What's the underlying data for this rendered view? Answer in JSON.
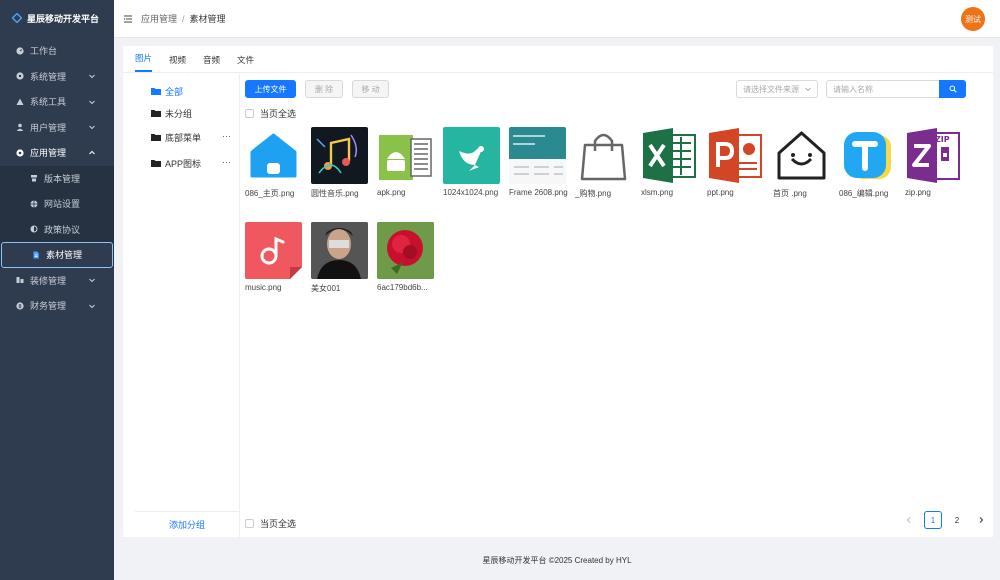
{
  "app": {
    "title": "星辰移动开发平台"
  },
  "sidebar": {
    "items": [
      {
        "label": "工作台",
        "icon": "dashboard-icon"
      },
      {
        "label": "系统管理",
        "icon": "settings-icon"
      },
      {
        "label": "系统工具",
        "icon": "tool-icon"
      },
      {
        "label": "用户管理",
        "icon": "user-icon"
      },
      {
        "label": "应用管理",
        "icon": "app-icon"
      },
      {
        "label": "版本管理",
        "icon": "version-icon"
      },
      {
        "label": "网站设置",
        "icon": "globe-icon"
      },
      {
        "label": "政策协议",
        "icon": "policy-icon"
      },
      {
        "label": "素材管理",
        "icon": "file-icon"
      },
      {
        "label": "装修管理",
        "icon": "decor-icon"
      },
      {
        "label": "财务管理",
        "icon": "finance-icon"
      }
    ]
  },
  "header": {
    "breadcrumb": [
      "应用管理",
      "/",
      "素材管理"
    ],
    "avatar_text": "测试"
  },
  "tabs": [
    "图片",
    "视频",
    "音频",
    "文件"
  ],
  "groups": [
    {
      "label": "全部"
    },
    {
      "label": "未分组"
    },
    {
      "label": "底部菜单",
      "more": "···"
    },
    {
      "label": "APP图标",
      "more": "···"
    }
  ],
  "add_group": "添加分组",
  "toolbar": {
    "upload": "上传文件",
    "delete": "删 除",
    "move": "移 动",
    "source_placeholder": "请选择文件来源",
    "search_placeholder": "请输入名称"
  },
  "select_all": "当页全选",
  "files": [
    {
      "name": "086_主页.png"
    },
    {
      "name": "圆性音乐.png"
    },
    {
      "name": "apk.png"
    },
    {
      "name": "1024x1024.png"
    },
    {
      "name": "Frame 2608.png"
    },
    {
      "name": "_购物.png"
    },
    {
      "name": "xlsm.png"
    },
    {
      "name": "ppt.png"
    },
    {
      "name": "首页 .png"
    },
    {
      "name": "086_编辑.png"
    },
    {
      "name": "zip.png"
    },
    {
      "name": "music.png"
    },
    {
      "name": "美女001"
    },
    {
      "name": "6ac179bd6b..."
    }
  ],
  "pagination": {
    "pages": [
      "1",
      "2"
    ],
    "current": "1"
  },
  "footer": "星辰移动开发平台 ©2025 Created by HYL",
  "colors": {
    "primary": "#1677ff",
    "sidebar": "#2f3b4e",
    "avatar": "#ee7316"
  }
}
